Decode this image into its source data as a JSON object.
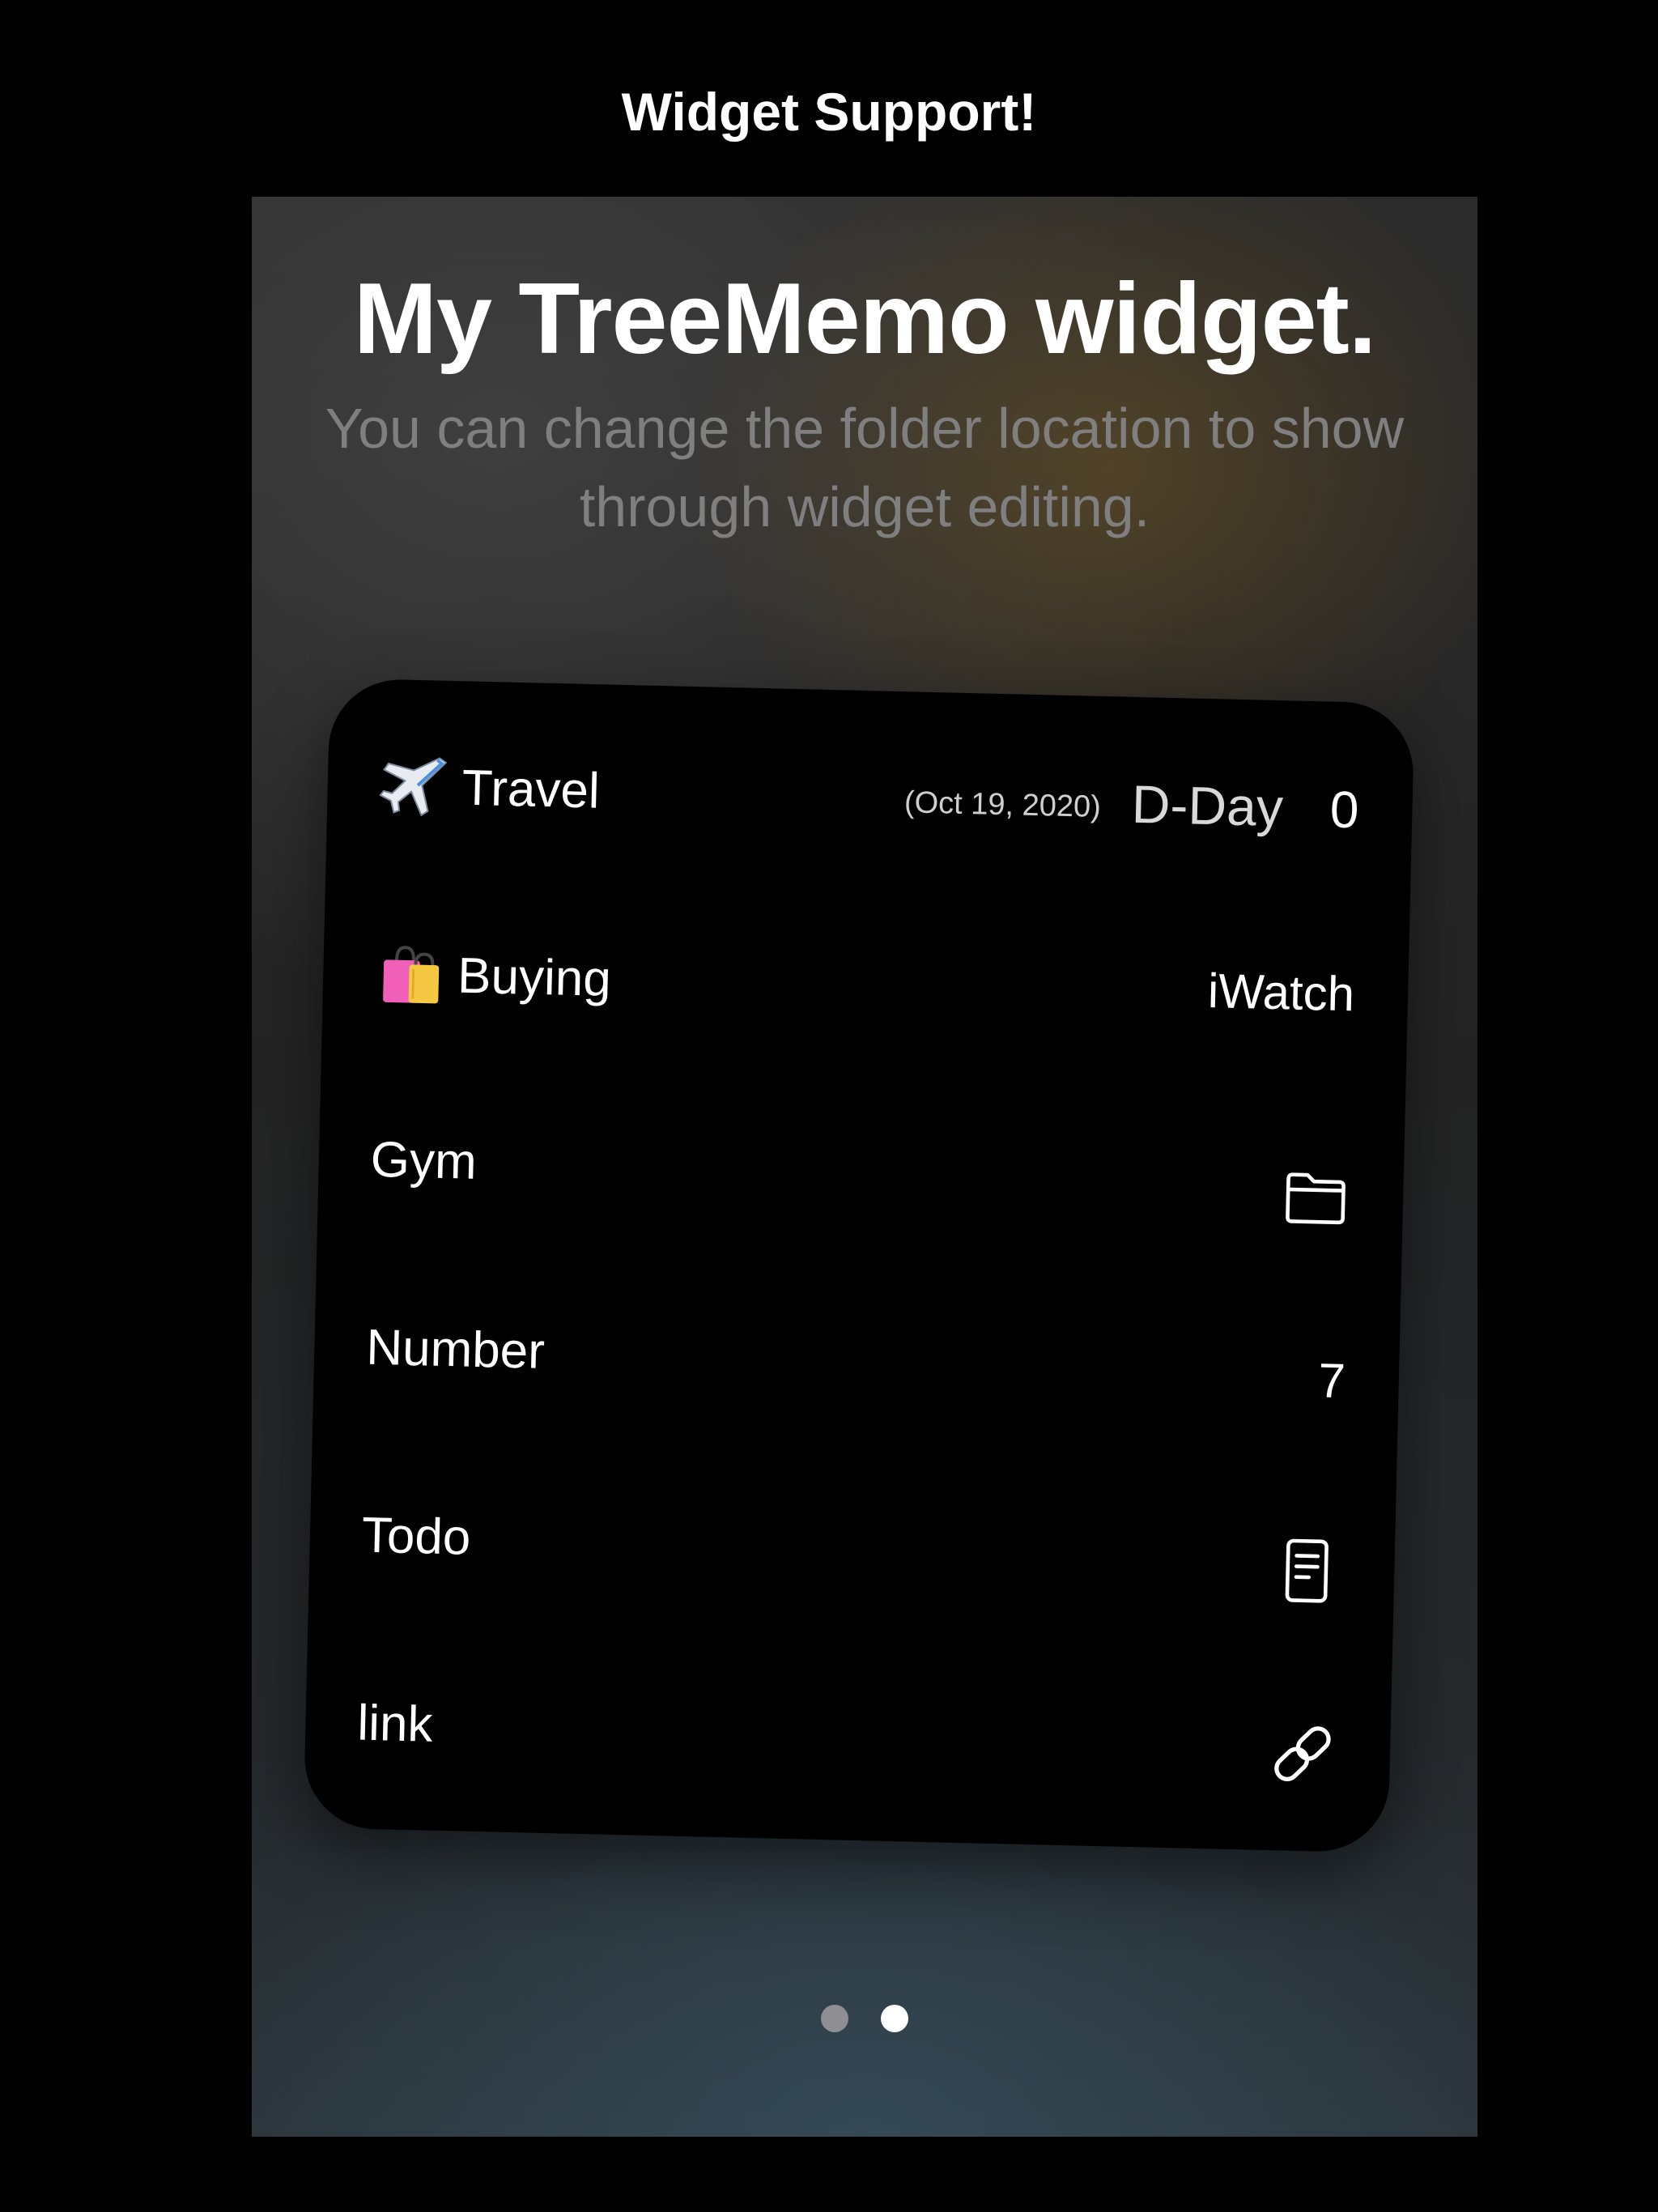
{
  "header": {
    "title": "Widget Support!"
  },
  "panel": {
    "heading": "My TreeMemo widget.",
    "subtitle_line1": "You can change the folder location to show",
    "subtitle_line2": "through widget editing."
  },
  "widget": {
    "rows": [
      {
        "label": "Travel",
        "emoji_icon": "airplane-icon",
        "dday_date": "(Oct 19, 2020)",
        "dday_label": "D-Day",
        "dday_value": "0"
      },
      {
        "label": "Buying",
        "emoji_icon": "shopping-bags-icon",
        "value": "iWatch"
      },
      {
        "label": "Gym",
        "right_icon": "folder-icon"
      },
      {
        "label": "Number",
        "value": "7"
      },
      {
        "label": "Todo",
        "right_icon": "document-icon"
      },
      {
        "label": "link",
        "right_icon": "link-icon"
      }
    ]
  },
  "pagination": {
    "pages": 2,
    "active_page": 2,
    "inactive_color": "#8e8e93",
    "active_color": "#ffffff"
  },
  "colors": {
    "background": "#000000",
    "widget_bg": "#000000",
    "subtitle": "#7f7f7f"
  }
}
